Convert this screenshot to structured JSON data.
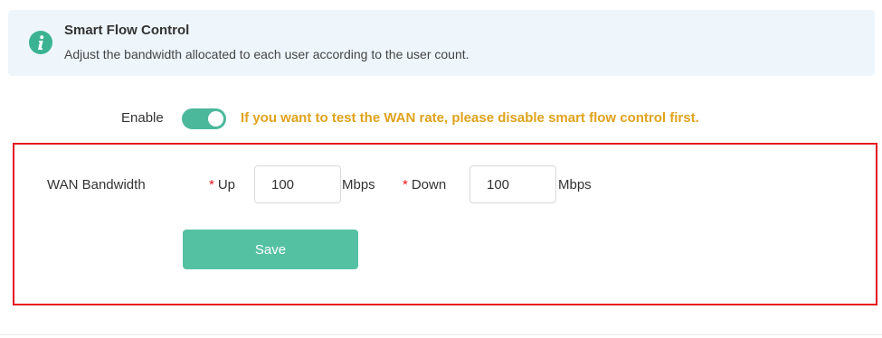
{
  "info": {
    "icon": "info-icon",
    "title": "Smart Flow Control",
    "description": "Adjust the bandwidth allocated to each user according to the user count."
  },
  "enable": {
    "label": "Enable",
    "state": "on",
    "warning": "If you want to test the WAN rate, please disable smart flow control first."
  },
  "wan": {
    "label": "WAN Bandwidth",
    "required_mark": "*",
    "up": {
      "label": "Up",
      "value": "100",
      "unit": "Mbps"
    },
    "down": {
      "label": "Down",
      "value": "100",
      "unit": "Mbps"
    }
  },
  "actions": {
    "save_label": "Save"
  },
  "colors": {
    "accent": "#4bb89b",
    "button": "#55c1a3",
    "warning": "#e0a21c",
    "highlight_border": "#e4161c",
    "banner_bg": "#eef6fc"
  }
}
